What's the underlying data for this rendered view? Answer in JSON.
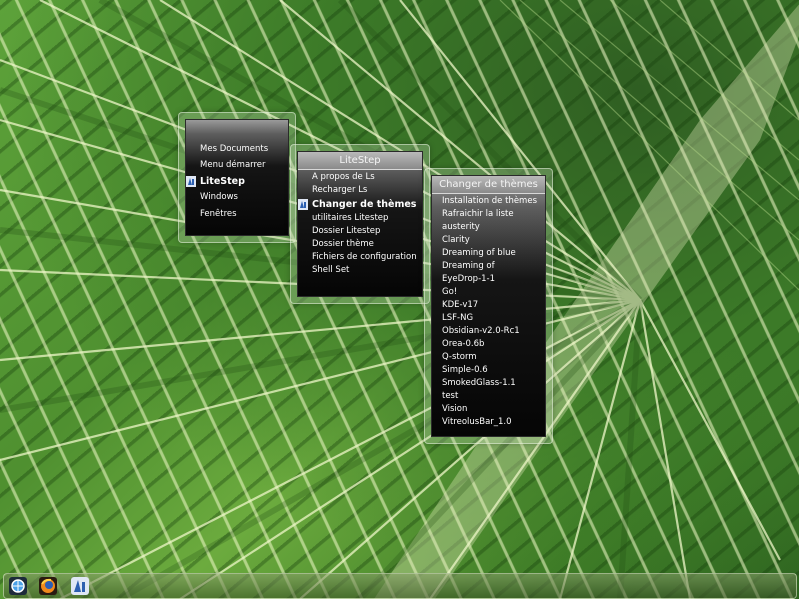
{
  "menu1": {
    "items": [
      {
        "label": "Mes Documents"
      },
      {
        "label": "Menu démarrer"
      },
      {
        "label": "LiteStep"
      },
      {
        "label": "Windows"
      },
      {
        "label": "Fenêtres"
      }
    ]
  },
  "menu2": {
    "title": "LiteStep",
    "items": [
      {
        "label": "A propos de Ls"
      },
      {
        "label": "Recharger Ls"
      },
      {
        "label": "Changer de thèmes"
      },
      {
        "label": "utilitaires Litestep"
      },
      {
        "label": "Dossier Litestep"
      },
      {
        "label": "Dossier thème"
      },
      {
        "label": "Fichiers de configuration"
      },
      {
        "label": "Shell Set"
      }
    ]
  },
  "menu3": {
    "title": "Changer de thèmes",
    "items": [
      {
        "label": "Installation de thèmes"
      },
      {
        "label": "Rafraichir la liste"
      },
      {
        "label": "austerity"
      },
      {
        "label": "Clarity"
      },
      {
        "label": "Dreaming of blue"
      },
      {
        "label": "Dreaming of"
      },
      {
        "label": "EyeDrop-1-1"
      },
      {
        "label": "Go!"
      },
      {
        "label": "KDE-v17"
      },
      {
        "label": "LSF-NG"
      },
      {
        "label": "Obsidian-v2.0-Rc1"
      },
      {
        "label": "Orea-0.6b"
      },
      {
        "label": "Q-storm"
      },
      {
        "label": "Simple-0.6"
      },
      {
        "label": "SmokedGlass-1.1"
      },
      {
        "label": "test"
      },
      {
        "label": "Vision"
      },
      {
        "label": "VitreolusBar_1.0"
      }
    ]
  },
  "taskbar": {
    "icons": [
      "litestep-globe-icon",
      "firefox-icon",
      "litestep-logo-icon"
    ]
  },
  "colors": {
    "menu_text": "#ffffff",
    "wallpaper_green": "#4f9030"
  }
}
